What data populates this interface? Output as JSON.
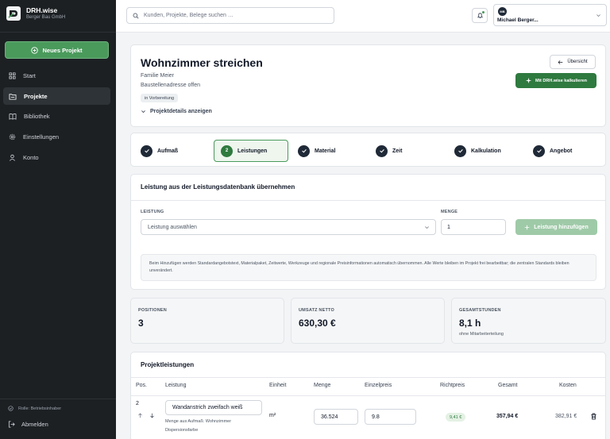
{
  "app": {
    "name": "DRH.wise",
    "company": "Berger Bau GmbH"
  },
  "sidebar": {
    "new_project_label": "Neues Projekt",
    "items": [
      {
        "label": "Start",
        "icon": "grid-icon"
      },
      {
        "label": "Projekte",
        "icon": "folder-icon",
        "active": true
      },
      {
        "label": "Bibliothek",
        "icon": "book-icon"
      },
      {
        "label": "Einstellungen",
        "icon": "gear-icon"
      },
      {
        "label": "Konto",
        "icon": "user-icon"
      }
    ],
    "role": "Rolle: Betriebsinhaber",
    "logout_label": "Abmelden"
  },
  "topbar": {
    "search_placeholder": "Kunden, Projekte, Belege suchen …",
    "user_initials": "MB",
    "user_name": "Michael Berger..."
  },
  "project": {
    "title": "Wohnzimmer streichen",
    "client": "Familie Meier",
    "address": "Baustellenadresse offen",
    "status": "in Vorbereitung",
    "details_label": "Projektdetails anzeigen",
    "overview_label": "Übersicht",
    "calc_label": "Mit DRH.wise kalkulieren"
  },
  "steps": [
    {
      "label": "Aufmaß",
      "done": true
    },
    {
      "label": "Leistungen",
      "number": "2",
      "active": true
    },
    {
      "label": "Material",
      "done": true
    },
    {
      "label": "Zeit",
      "done": true
    },
    {
      "label": "Kalkulation",
      "done": true
    },
    {
      "label": "Angebot",
      "done": true
    }
  ],
  "add_service": {
    "title": "Leistung aus der Leistungsdatenbank übernehmen",
    "service_label": "LEISTUNG",
    "service_placeholder": "Leistung auswählen",
    "qty_label": "MENGE",
    "qty_value": "1",
    "add_button": "Leistung hinzufügen",
    "info": "Beim Hinzufügen werden Standardangebotstext, Materialpaket, Zeitwerte, Werkzeuge und regionale Preisinformationen automatisch übernommen. Alle Werte bleiben im Projekt frei bearbeitbar; die zentralen Standards bleiben unverändert."
  },
  "stats": [
    {
      "label": "POSITIONEN",
      "value": "3",
      "sub": ""
    },
    {
      "label": "UMSATZ NETTO",
      "value": "630,30 €",
      "sub": ""
    },
    {
      "label": "GESAMTSTUNDEN",
      "value": "8,1 h",
      "sub": "ohne Mitarbeiterteilung"
    }
  ],
  "table": {
    "title": "Projektleistungen",
    "headers": [
      "Pos.",
      "Leistung",
      "Einheit",
      "Menge",
      "Einzelpreis",
      "Richtpreis",
      "Gesamt",
      "Kosten"
    ],
    "rows": [
      {
        "pos": "2",
        "name": "Wandanstrich zweifach weiß",
        "note1": "Menge aus Aufmaß: Wohnzimmer",
        "note2": "Dispersionsfarbe",
        "unit": "m²",
        "qty": "36.524",
        "unit_price": "9.8",
        "guide_price": "9,41 €",
        "total": "357,94 €",
        "cost": "382,91 €"
      }
    ]
  },
  "colors": {
    "accent": "#2f7a3f",
    "sidebar": "#1c2023",
    "accent_light": "#4a9a5c"
  }
}
